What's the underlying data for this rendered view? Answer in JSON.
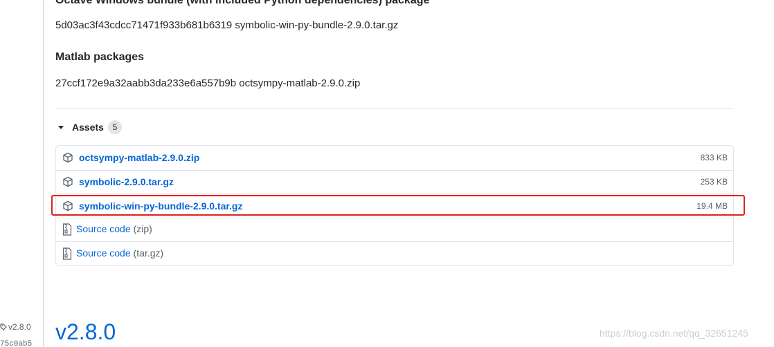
{
  "left_rail": {
    "tag_label": "v2.8.0",
    "commit_hash": "75c0ab5"
  },
  "sections": [
    {
      "heading": "Octave Windows bundle (with included Python dependencies) package",
      "hash_line": "5d03ac3f43cdcc71471f933b681b6319 symbolic-win-py-bundle-2.9.0.tar.gz"
    },
    {
      "heading": "Matlab packages",
      "hash_line": "27ccf172e9a32aabb3da233e6a557b9b octsympy-matlab-2.9.0.zip"
    }
  ],
  "assets": {
    "label": "Assets",
    "count": "5",
    "files": [
      {
        "name": "octsympy-matlab-2.9.0.zip",
        "size": "833 KB"
      },
      {
        "name": "symbolic-2.9.0.tar.gz",
        "size": "253 KB"
      },
      {
        "name": "symbolic-win-py-bundle-2.9.0.tar.gz",
        "size": "19.4 MB"
      }
    ],
    "sources": [
      {
        "label": "Source code",
        "suffix": "(zip)"
      },
      {
        "label": "Source code",
        "suffix": "(tar.gz)"
      }
    ]
  },
  "next_release": {
    "title": "v2.8.0"
  },
  "watermark": "https://blog.csdn.net/qq_32651245",
  "colors": {
    "link": "#0366d6",
    "highlight": "#e0201b",
    "muted": "#586069"
  }
}
